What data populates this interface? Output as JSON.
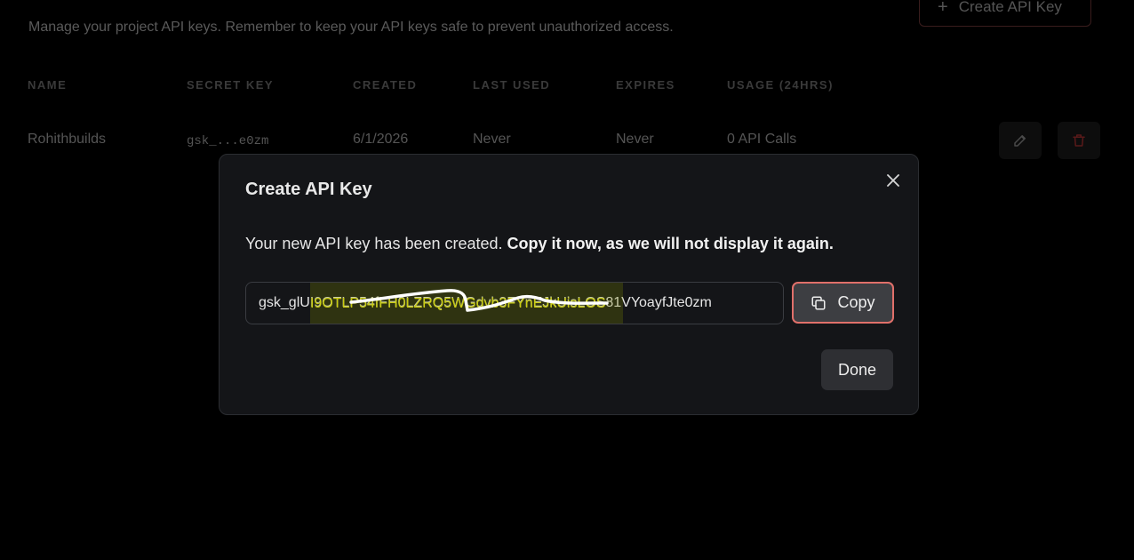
{
  "background": {
    "description": "Manage your project API keys. Remember to keep your API keys safe to prevent unauthorized access.",
    "create_button_label": "Create API Key",
    "columns": [
      "NAME",
      "SECRET KEY",
      "CREATED",
      "LAST USED",
      "EXPIRES",
      "USAGE (24HRS)"
    ],
    "rows": [
      {
        "name": "Rohithbuilds",
        "secret_key": "gsk_...e0zm",
        "created": "6/1/2026",
        "last_used": "Never",
        "expires": "Never",
        "usage": "0 API Calls"
      }
    ]
  },
  "modal": {
    "title": "Create API Key",
    "message_plain": "Your new API key has been created.",
    "message_bold": "Copy it now, as we will not display it again.",
    "key_value": "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",
    "redacted_overlay_text": "I9OTLP54fFH0LZRQ5WGdvb3FYnEJkUisLOS",
    "copy_label": "Copy",
    "done_label": "Done"
  },
  "colors": {
    "modal_bg": "#141518",
    "copy_border": "#e0706a",
    "redaction": "#c9cc10"
  },
  "icons": [
    "plus-icon",
    "edit-icon",
    "trash-icon",
    "close-icon",
    "copy-icon"
  ]
}
